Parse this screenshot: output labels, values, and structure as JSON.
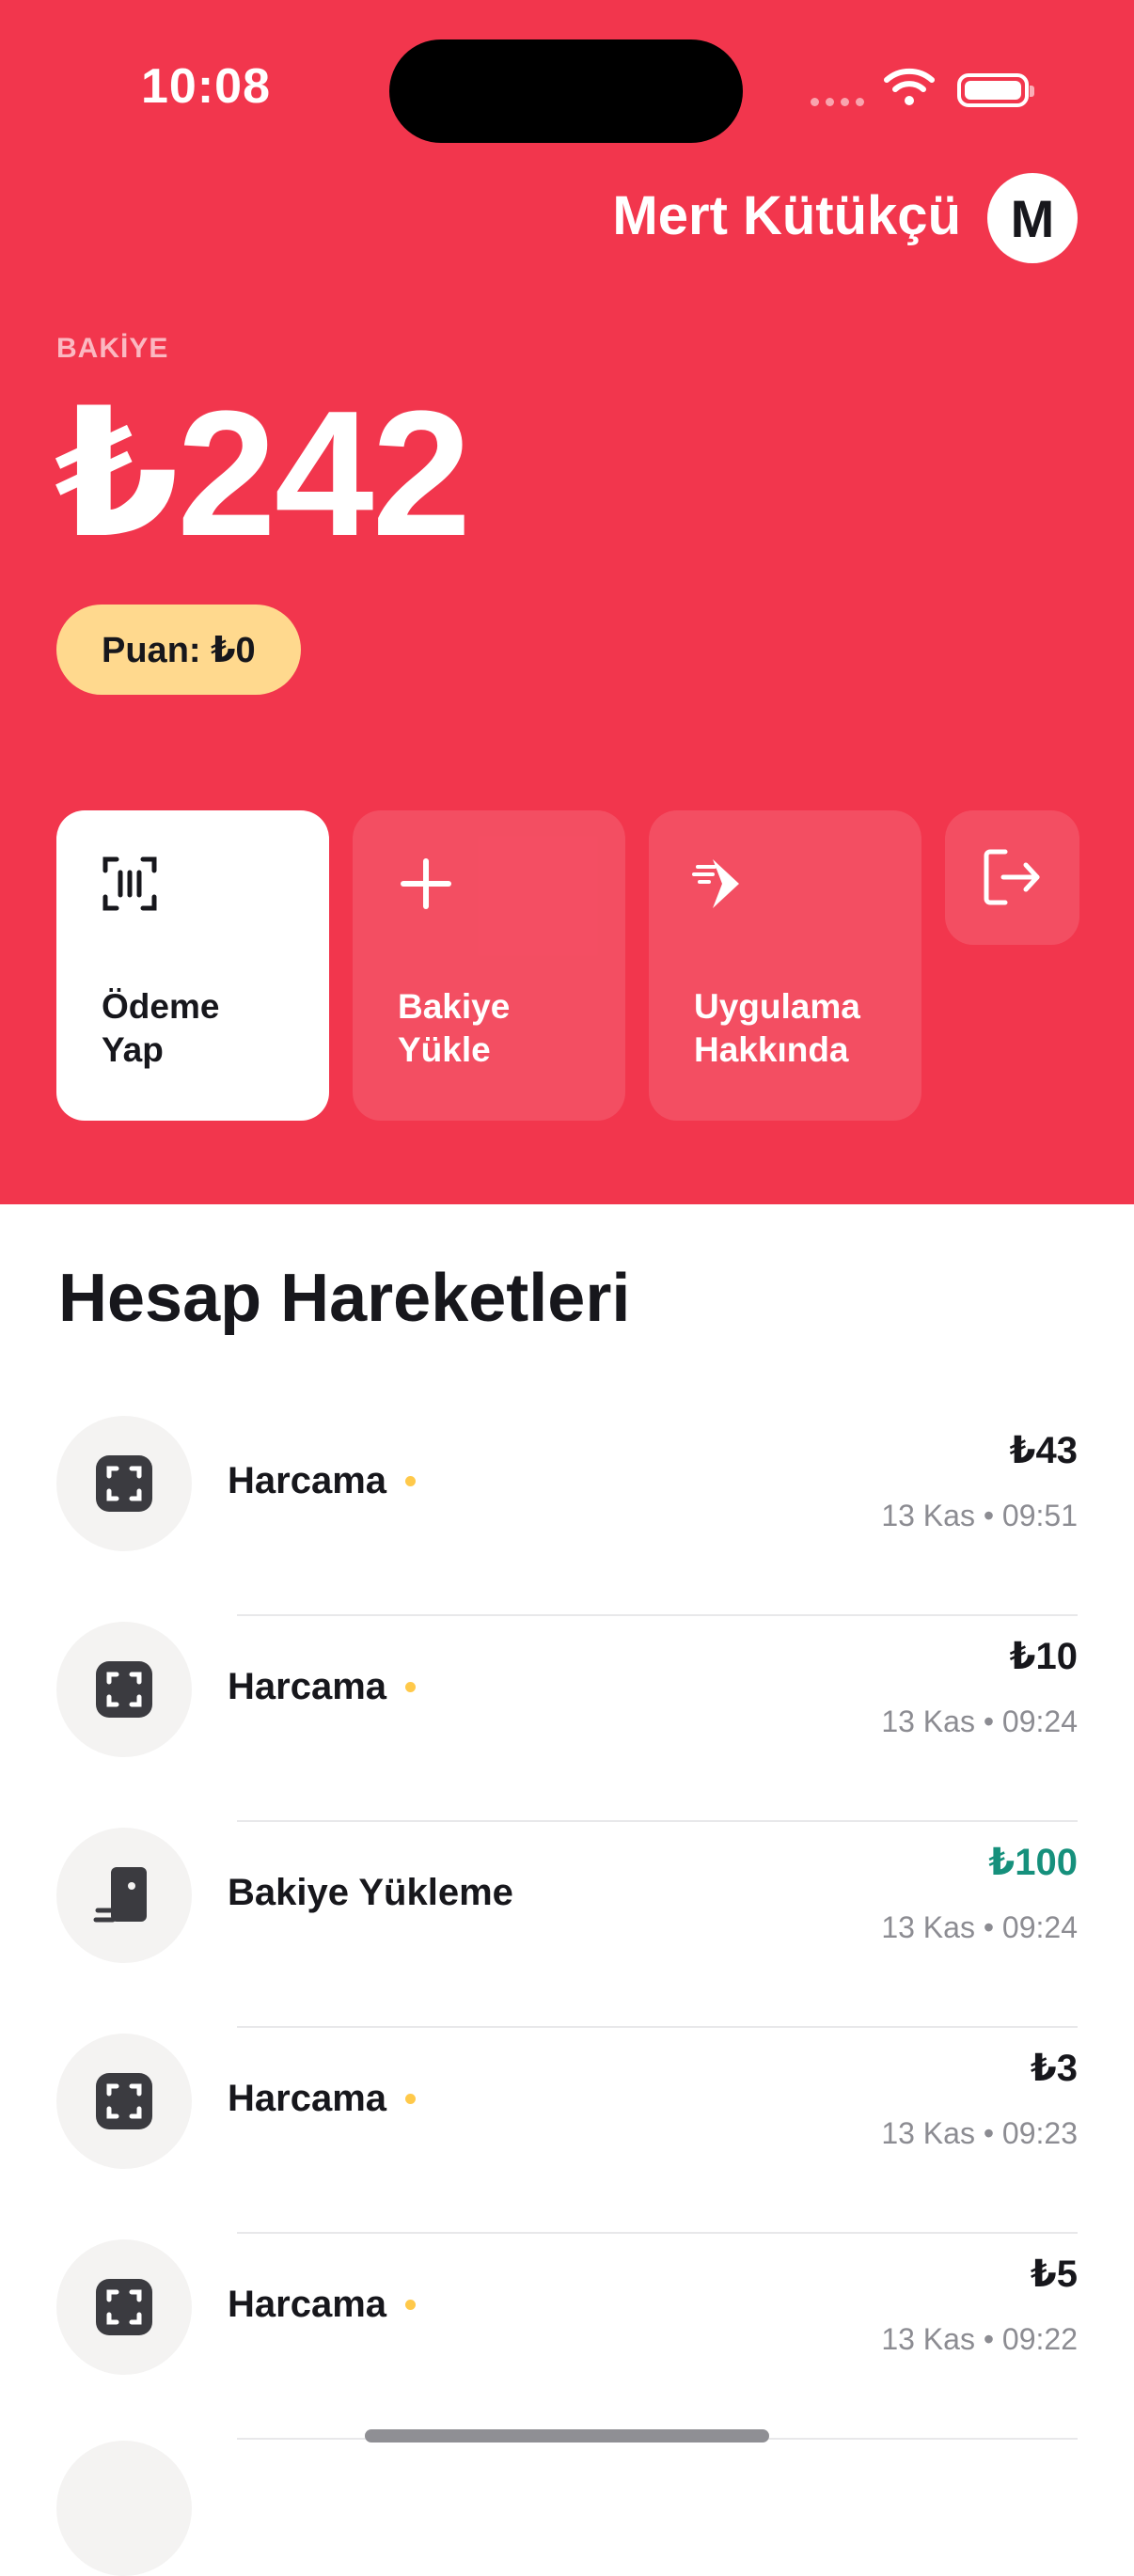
{
  "status_bar": {
    "time": "10:08"
  },
  "user": {
    "name": "Mert Kütükçü",
    "avatar_initial": "M"
  },
  "balance": {
    "label": "BAKİYE",
    "amount": "₺242",
    "points": "Puan: ₺0"
  },
  "actions": [
    {
      "label": "Ödeme\nYap",
      "icon": "barcode-scan-icon"
    },
    {
      "label": "Bakiye\nYükle",
      "icon": "plus-icon"
    },
    {
      "label": "Uygulama\nHakkında",
      "icon": "fast-arrow-icon"
    },
    {
      "label": "",
      "icon": "logout-icon"
    }
  ],
  "transactions_section": {
    "title": "Hesap Hareketleri"
  },
  "transactions": [
    {
      "title": "Harcama",
      "amount": "₺43",
      "date": "13 Kas • 09:51",
      "type": "spend",
      "icon": "scan-frame-icon"
    },
    {
      "title": "Harcama",
      "amount": "₺10",
      "date": "13 Kas • 09:24",
      "type": "spend",
      "icon": "scan-frame-icon"
    },
    {
      "title": "Bakiye Yükleme",
      "amount": "₺100",
      "date": "13 Kas • 09:24",
      "type": "topup",
      "icon": "card-reader-icon"
    },
    {
      "title": "Harcama",
      "amount": "₺3",
      "date": "13 Kas • 09:23",
      "type": "spend",
      "icon": "scan-frame-icon"
    },
    {
      "title": "Harcama",
      "amount": "₺5",
      "date": "13 Kas • 09:22",
      "type": "spend",
      "icon": "scan-frame-icon"
    }
  ],
  "colors": {
    "brand": "#f2364d",
    "points_pill": "#ffd98e",
    "positive": "#16907c",
    "pending_dot": "#ffc94a"
  }
}
